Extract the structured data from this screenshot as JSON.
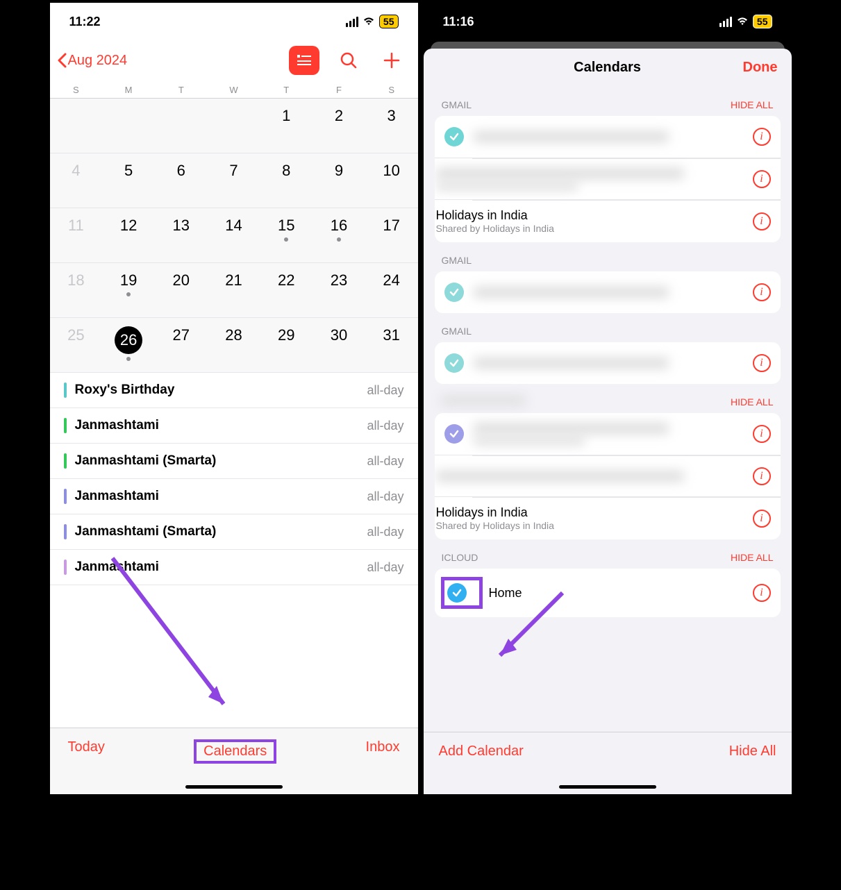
{
  "left": {
    "status": {
      "time": "11:22",
      "battery": "55"
    },
    "header": {
      "back_label": "Aug 2024"
    },
    "weekdays": [
      "S",
      "M",
      "T",
      "W",
      "T",
      "F",
      "S"
    ],
    "grid": [
      [
        {
          "n": "",
          "dim": false
        },
        {
          "n": "",
          "dim": false
        },
        {
          "n": "",
          "dim": false
        },
        {
          "n": "",
          "dim": false
        },
        {
          "n": "1",
          "dim": false
        },
        {
          "n": "2",
          "dim": false
        },
        {
          "n": "3",
          "dim": false
        }
      ],
      [
        {
          "n": "4",
          "dim": true
        },
        {
          "n": "5",
          "dim": false
        },
        {
          "n": "6",
          "dim": false
        },
        {
          "n": "7",
          "dim": false
        },
        {
          "n": "8",
          "dim": false
        },
        {
          "n": "9",
          "dim": false
        },
        {
          "n": "10",
          "dim": false
        }
      ],
      [
        {
          "n": "11",
          "dim": true
        },
        {
          "n": "12",
          "dim": false
        },
        {
          "n": "13",
          "dim": false
        },
        {
          "n": "14",
          "dim": false
        },
        {
          "n": "15",
          "dim": false,
          "dot": true
        },
        {
          "n": "16",
          "dim": false,
          "dot": true
        },
        {
          "n": "17",
          "dim": false
        }
      ],
      [
        {
          "n": "18",
          "dim": true
        },
        {
          "n": "19",
          "dim": false,
          "dot": true
        },
        {
          "n": "20",
          "dim": false
        },
        {
          "n": "21",
          "dim": false
        },
        {
          "n": "22",
          "dim": false
        },
        {
          "n": "23",
          "dim": false
        },
        {
          "n": "24",
          "dim": false
        }
      ],
      [
        {
          "n": "25",
          "dim": true
        },
        {
          "n": "26",
          "dim": false,
          "today": true,
          "dot": true
        },
        {
          "n": "27",
          "dim": false
        },
        {
          "n": "28",
          "dim": false
        },
        {
          "n": "29",
          "dim": false
        },
        {
          "n": "30",
          "dim": false
        },
        {
          "n": "31",
          "dim": false
        }
      ]
    ],
    "events": [
      {
        "title": "Roxy's Birthday",
        "time": "all-day",
        "color": "#5ac8c8"
      },
      {
        "title": "Janmashtami",
        "time": "all-day",
        "color": "#34c759"
      },
      {
        "title": "Janmashtami (Smarta)",
        "time": "all-day",
        "color": "#34c759"
      },
      {
        "title": "Janmashtami",
        "time": "all-day",
        "color": "#8e8ede"
      },
      {
        "title": "Janmashtami (Smarta)",
        "time": "all-day",
        "color": "#8e8ede"
      },
      {
        "title": "Janmashtami",
        "time": "all-day",
        "color": "#c89ae0"
      }
    ],
    "toolbar": {
      "today": "Today",
      "calendars": "Calendars",
      "inbox": "Inbox"
    }
  },
  "right": {
    "status": {
      "time": "11:16",
      "battery": "55"
    },
    "sheet_title": "Calendars",
    "done": "Done",
    "hide_all": "HIDE ALL",
    "sections": [
      {
        "label": "GMAIL",
        "hide": true,
        "items": [
          {
            "blurred": true,
            "color": "#6fd5d5"
          },
          {
            "blurred": true,
            "two": true,
            "color": "#6fd5d5",
            "dotted": true
          },
          {
            "name": "Holidays in India",
            "sub": "Shared by Holidays in India",
            "color": "#1a9e5c"
          }
        ]
      },
      {
        "label": "GMAIL",
        "hide": false,
        "items": [
          {
            "blurred": true,
            "color": "#8ed9d9"
          }
        ]
      },
      {
        "label": "GMAIL",
        "hide": false,
        "items": [
          {
            "blurred": true,
            "color": "#8ed9d9"
          }
        ]
      },
      {
        "label": "",
        "hide": true,
        "blurred_label": true,
        "items": [
          {
            "blurred": true,
            "two": true,
            "color": "#9e9ee8"
          },
          {
            "blurred": true,
            "color": "#bce5e5"
          },
          {
            "name": "Holidays in India",
            "sub": "Shared by Holidays in India",
            "color": "#9e9ee8"
          }
        ]
      },
      {
        "label": "ICLOUD",
        "hide": true,
        "items": [
          {
            "name": "Home",
            "color": "#30b0f0",
            "highlighted": true
          }
        ]
      }
    ],
    "bottom": {
      "add": "Add Calendar",
      "hide": "Hide All"
    }
  }
}
